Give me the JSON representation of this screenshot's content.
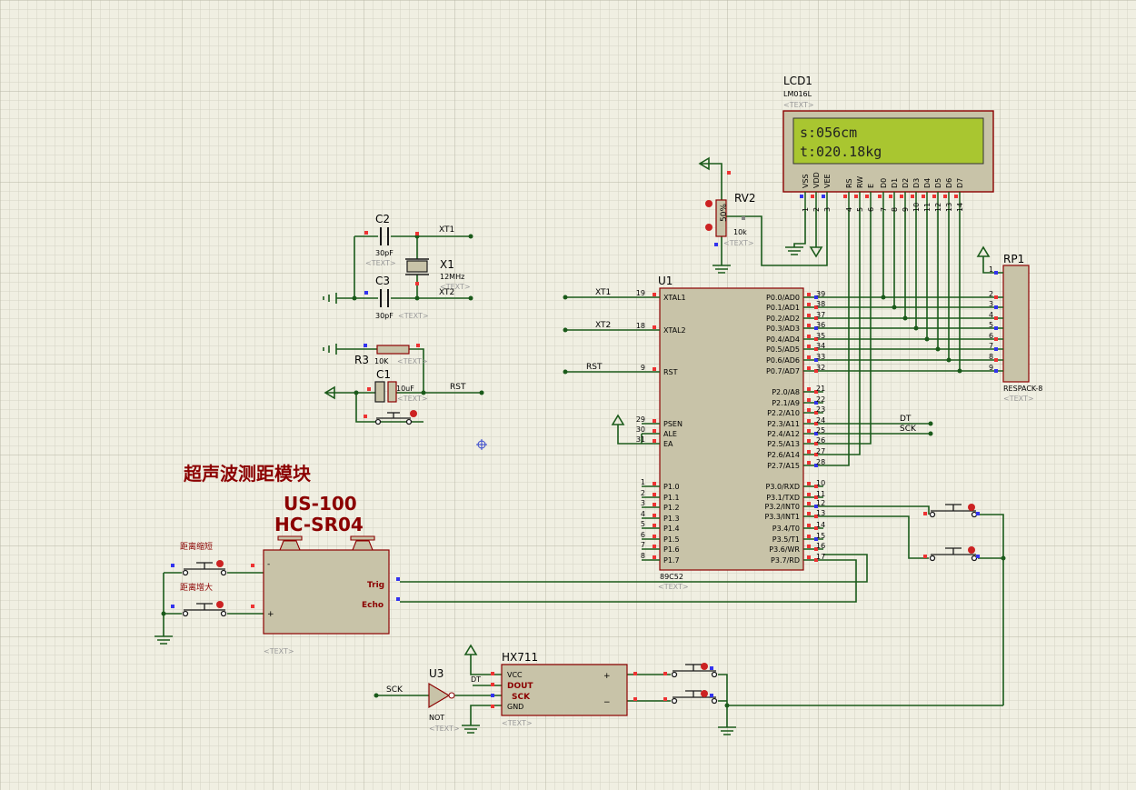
{
  "title_cn": "超声波测距模块",
  "sensor": {
    "model1": "US-100",
    "model2": "HC-SR04",
    "pin_minus": "-",
    "pin_plus": "+",
    "pin_trig": "Trig",
    "pin_echo": "Echo",
    "text_tag": "<TEXT>"
  },
  "buttons": {
    "shorten": "距离缩短",
    "lengthen": "距离增大"
  },
  "lcd": {
    "ref": "LCD1",
    "model": "LM016L",
    "tag": "<TEXT>",
    "line1": "s:056cm",
    "line2": "t:020.18kg",
    "pins": [
      "VSS",
      "VDD",
      "VEE",
      "RS",
      "RW",
      "E",
      "D0",
      "D1",
      "D2",
      "D3",
      "D4",
      "D5",
      "D6",
      "D7"
    ],
    "pin_nums": [
      "1",
      "2",
      "3",
      "4",
      "5",
      "6",
      "7",
      "8",
      "9",
      "10",
      "11",
      "12",
      "13",
      "14"
    ]
  },
  "rv2": {
    "ref": "RV2",
    "value": "10k",
    "tag": "<TEXT>",
    "percent": "50%"
  },
  "rp1": {
    "ref": "RP1",
    "model": "RESPACK-8",
    "tag": "<TEXT>",
    "pins": [
      "1",
      "2",
      "3",
      "4",
      "5",
      "6",
      "7",
      "8",
      "9"
    ]
  },
  "osc": {
    "c2": "C2",
    "c2val": "30pF",
    "c2tag": "<TEXT>",
    "c3": "C3",
    "c3val": "30pF",
    "c3tag": "<TEXT>",
    "x1": "X1",
    "x1val": "12MHz",
    "x1tag": "<TEXT>",
    "xt1": "XT1",
    "xt2": "XT2"
  },
  "reset": {
    "r3": "R3",
    "r3val": "10K",
    "r3tag": "<TEXT>",
    "c1": "C1",
    "c1val": "10uF",
    "c1tag": "<TEXT>",
    "rst": "RST"
  },
  "mcu": {
    "ref": "U1",
    "model": "89C52",
    "tag": "<TEXT>",
    "left": [
      {
        "num": "19",
        "name": "XTAL1",
        "net": "XT1"
      },
      {
        "num": "18",
        "name": "XTAL2",
        "net": "XT2"
      },
      {
        "num": "9",
        "name": "RST",
        "net": "RST"
      },
      {
        "num": "29",
        "name": "PSEN",
        "net": ""
      },
      {
        "num": "30",
        "name": "ALE",
        "net": ""
      },
      {
        "num": "31",
        "name": "EA",
        "net": ""
      },
      {
        "num": "1",
        "name": "P1.0",
        "net": ""
      },
      {
        "num": "2",
        "name": "P1.1",
        "net": ""
      },
      {
        "num": "3",
        "name": "P1.2",
        "net": ""
      },
      {
        "num": "4",
        "name": "P1.3",
        "net": ""
      },
      {
        "num": "5",
        "name": "P1.4",
        "net": ""
      },
      {
        "num": "6",
        "name": "P1.5",
        "net": ""
      },
      {
        "num": "7",
        "name": "P1.6",
        "net": ""
      },
      {
        "num": "8",
        "name": "P1.7",
        "net": ""
      }
    ],
    "right": [
      {
        "num": "39",
        "name": "P0.0/AD0"
      },
      {
        "num": "38",
        "name": "P0.1/AD1"
      },
      {
        "num": "37",
        "name": "P0.2/AD2"
      },
      {
        "num": "36",
        "name": "P0.3/AD3"
      },
      {
        "num": "35",
        "name": "P0.4/AD4"
      },
      {
        "num": "34",
        "name": "P0.5/AD5"
      },
      {
        "num": "33",
        "name": "P0.6/AD6"
      },
      {
        "num": "32",
        "name": "P0.7/AD7"
      },
      {
        "num": "21",
        "name": "P2.0/A8"
      },
      {
        "num": "22",
        "name": "P2.1/A9"
      },
      {
        "num": "23",
        "name": "P2.2/A10"
      },
      {
        "num": "24",
        "name": "P2.3/A11"
      },
      {
        "num": "25",
        "name": "P2.4/A12"
      },
      {
        "num": "26",
        "name": "P2.5/A13"
      },
      {
        "num": "27",
        "name": "P2.6/A14"
      },
      {
        "num": "28",
        "name": "P2.7/A15"
      },
      {
        "num": "10",
        "name": "P3.0/RXD"
      },
      {
        "num": "11",
        "name": "P3.1/TXD"
      },
      {
        "num": "12",
        "name": "P3.2/INT0"
      },
      {
        "num": "13",
        "name": "P3.3/INT1"
      },
      {
        "num": "14",
        "name": "P3.4/T0"
      },
      {
        "num": "15",
        "name": "P3.5/T1"
      },
      {
        "num": "16",
        "name": "P3.6/WR"
      },
      {
        "num": "17",
        "name": "P3.7/RD"
      }
    ],
    "dt": "DT",
    "sck": "SCK"
  },
  "hx711": {
    "ref": "HX711",
    "vcc": "VCC",
    "dout": "DOUT",
    "sck": "SCK",
    "gnd": "GND",
    "plus": "+",
    "minus": "−",
    "tag": "<TEXT>",
    "dt": "DT"
  },
  "u3": {
    "ref": "U3",
    "model": "NOT",
    "tag": "<TEXT>",
    "sck": "SCK"
  },
  "colors": {
    "wire": "#1a5a1a",
    "component_fill": "#c8c3a8",
    "component_stroke": "#8b0000",
    "lcd_screen": "#a9c630",
    "grid_minor": "#d4d3c4",
    "grid_major": "#b8b7a6",
    "pin_red": "#ee3333",
    "pin_blue": "#3333ee",
    "label_red": "#8b0000"
  }
}
